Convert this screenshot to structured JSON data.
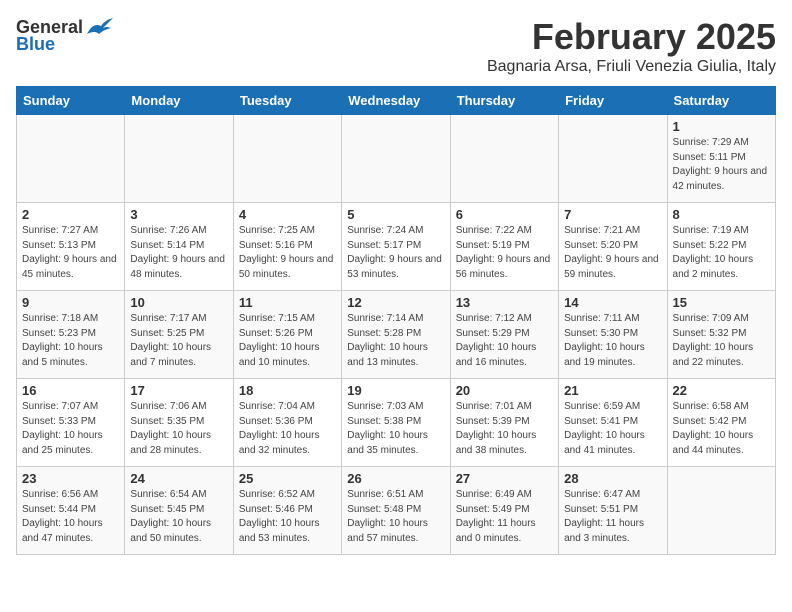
{
  "logo": {
    "general": "General",
    "blue": "Blue"
  },
  "title": "February 2025",
  "subtitle": "Bagnaria Arsa, Friuli Venezia Giulia, Italy",
  "days_of_week": [
    "Sunday",
    "Monday",
    "Tuesday",
    "Wednesday",
    "Thursday",
    "Friday",
    "Saturday"
  ],
  "weeks": [
    [
      {
        "day": "",
        "info": ""
      },
      {
        "day": "",
        "info": ""
      },
      {
        "day": "",
        "info": ""
      },
      {
        "day": "",
        "info": ""
      },
      {
        "day": "",
        "info": ""
      },
      {
        "day": "",
        "info": ""
      },
      {
        "day": "1",
        "info": "Sunrise: 7:29 AM\nSunset: 5:11 PM\nDaylight: 9 hours and 42 minutes."
      }
    ],
    [
      {
        "day": "2",
        "info": "Sunrise: 7:27 AM\nSunset: 5:13 PM\nDaylight: 9 hours and 45 minutes."
      },
      {
        "day": "3",
        "info": "Sunrise: 7:26 AM\nSunset: 5:14 PM\nDaylight: 9 hours and 48 minutes."
      },
      {
        "day": "4",
        "info": "Sunrise: 7:25 AM\nSunset: 5:16 PM\nDaylight: 9 hours and 50 minutes."
      },
      {
        "day": "5",
        "info": "Sunrise: 7:24 AM\nSunset: 5:17 PM\nDaylight: 9 hours and 53 minutes."
      },
      {
        "day": "6",
        "info": "Sunrise: 7:22 AM\nSunset: 5:19 PM\nDaylight: 9 hours and 56 minutes."
      },
      {
        "day": "7",
        "info": "Sunrise: 7:21 AM\nSunset: 5:20 PM\nDaylight: 9 hours and 59 minutes."
      },
      {
        "day": "8",
        "info": "Sunrise: 7:19 AM\nSunset: 5:22 PM\nDaylight: 10 hours and 2 minutes."
      }
    ],
    [
      {
        "day": "9",
        "info": "Sunrise: 7:18 AM\nSunset: 5:23 PM\nDaylight: 10 hours and 5 minutes."
      },
      {
        "day": "10",
        "info": "Sunrise: 7:17 AM\nSunset: 5:25 PM\nDaylight: 10 hours and 7 minutes."
      },
      {
        "day": "11",
        "info": "Sunrise: 7:15 AM\nSunset: 5:26 PM\nDaylight: 10 hours and 10 minutes."
      },
      {
        "day": "12",
        "info": "Sunrise: 7:14 AM\nSunset: 5:28 PM\nDaylight: 10 hours and 13 minutes."
      },
      {
        "day": "13",
        "info": "Sunrise: 7:12 AM\nSunset: 5:29 PM\nDaylight: 10 hours and 16 minutes."
      },
      {
        "day": "14",
        "info": "Sunrise: 7:11 AM\nSunset: 5:30 PM\nDaylight: 10 hours and 19 minutes."
      },
      {
        "day": "15",
        "info": "Sunrise: 7:09 AM\nSunset: 5:32 PM\nDaylight: 10 hours and 22 minutes."
      }
    ],
    [
      {
        "day": "16",
        "info": "Sunrise: 7:07 AM\nSunset: 5:33 PM\nDaylight: 10 hours and 25 minutes."
      },
      {
        "day": "17",
        "info": "Sunrise: 7:06 AM\nSunset: 5:35 PM\nDaylight: 10 hours and 28 minutes."
      },
      {
        "day": "18",
        "info": "Sunrise: 7:04 AM\nSunset: 5:36 PM\nDaylight: 10 hours and 32 minutes."
      },
      {
        "day": "19",
        "info": "Sunrise: 7:03 AM\nSunset: 5:38 PM\nDaylight: 10 hours and 35 minutes."
      },
      {
        "day": "20",
        "info": "Sunrise: 7:01 AM\nSunset: 5:39 PM\nDaylight: 10 hours and 38 minutes."
      },
      {
        "day": "21",
        "info": "Sunrise: 6:59 AM\nSunset: 5:41 PM\nDaylight: 10 hours and 41 minutes."
      },
      {
        "day": "22",
        "info": "Sunrise: 6:58 AM\nSunset: 5:42 PM\nDaylight: 10 hours and 44 minutes."
      }
    ],
    [
      {
        "day": "23",
        "info": "Sunrise: 6:56 AM\nSunset: 5:44 PM\nDaylight: 10 hours and 47 minutes."
      },
      {
        "day": "24",
        "info": "Sunrise: 6:54 AM\nSunset: 5:45 PM\nDaylight: 10 hours and 50 minutes."
      },
      {
        "day": "25",
        "info": "Sunrise: 6:52 AM\nSunset: 5:46 PM\nDaylight: 10 hours and 53 minutes."
      },
      {
        "day": "26",
        "info": "Sunrise: 6:51 AM\nSunset: 5:48 PM\nDaylight: 10 hours and 57 minutes."
      },
      {
        "day": "27",
        "info": "Sunrise: 6:49 AM\nSunset: 5:49 PM\nDaylight: 11 hours and 0 minutes."
      },
      {
        "day": "28",
        "info": "Sunrise: 6:47 AM\nSunset: 5:51 PM\nDaylight: 11 hours and 3 minutes."
      },
      {
        "day": "",
        "info": ""
      }
    ]
  ]
}
